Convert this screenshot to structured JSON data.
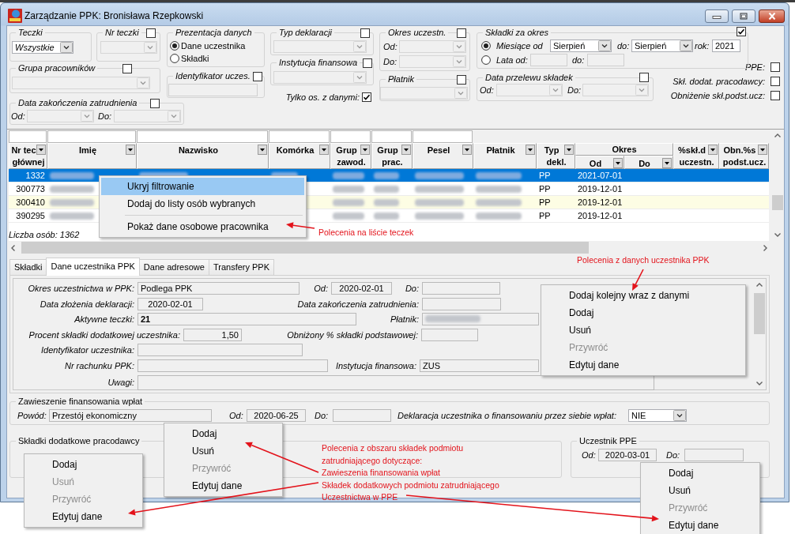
{
  "window": {
    "title": "Zarządzanie PPK: Bronisława Rzepkowski"
  },
  "filters": {
    "teczki": {
      "label": "Teczki",
      "value": "Wszystkie"
    },
    "nr_teczki": {
      "label": "Nr teczki",
      "checked": false
    },
    "grupa_pracownikow": {
      "label": "Grupa pracowników",
      "checked": false
    },
    "prezentacja_danych": {
      "label": "Prezentacja danych",
      "options": [
        {
          "label": "Dane uczestnika",
          "selected": true
        },
        {
          "label": "Składki",
          "selected": false
        }
      ]
    },
    "identyfikator_uczes": {
      "label": "Identyfikator uczes.",
      "checked": false
    },
    "data_zakonczenia_zatrudnienia": {
      "label": "Data zakończenia zatrudnienia",
      "checked": false,
      "from_label": "Od:",
      "to_label": "Do:"
    },
    "typ_deklaracji": {
      "label": "Typ deklaracji",
      "checked": false
    },
    "instytucja_finansowa": {
      "label": "Instytucja finansowa",
      "checked": false
    },
    "tylko_os_z_danymi": {
      "label": "Tylko os. z danymi:",
      "checked": true
    },
    "okres_uczestn": {
      "label": "Okres uczestn.",
      "checked": false,
      "from_label": "Od:",
      "to_label": "Do:"
    },
    "platnik": {
      "label": "Płatnik",
      "checked": false
    },
    "skladki_za_okres": {
      "label": "Składki za okres",
      "checked": true,
      "months": {
        "label": "Miesiące od",
        "selected": true,
        "from": "Sierpień",
        "to_label": "do:",
        "to": "Sierpień",
        "year_label": "rok:",
        "year": "2021"
      },
      "years": {
        "label": "Lata od:",
        "selected": false,
        "to_label": "do:"
      }
    },
    "data_przelewu_skladek": {
      "label": "Data przelewu składek",
      "checked": false,
      "from_label": "Od:",
      "to_label": "Do:"
    },
    "flags": [
      {
        "label": "PPE:",
        "checked": false
      },
      {
        "label": "Skł. dodat. pracodawcy:",
        "checked": false
      },
      {
        "label": "Obniżenie skł.podst.ucz:",
        "checked": false
      }
    ]
  },
  "table": {
    "columns": [
      {
        "lines": [
          "Nr tec",
          "głównej"
        ],
        "filter": true
      },
      {
        "lines": [
          "Imię"
        ],
        "filter": true
      },
      {
        "lines": [
          "Nazwisko"
        ],
        "filter": true
      },
      {
        "lines": [
          "Komórka"
        ],
        "filter": true
      },
      {
        "lines": [
          "Grup",
          "zawod."
        ],
        "filter": true
      },
      {
        "lines": [
          "Grup",
          "prac."
        ],
        "filter": true
      },
      {
        "lines": [
          "Pesel"
        ],
        "filter": true
      },
      {
        "lines": [
          "Płatnik"
        ],
        "filter": false
      },
      {
        "lines": [
          "Typ",
          "dekl."
        ],
        "filter": false
      },
      {
        "lines": [
          "Okres"
        ],
        "filter": false,
        "subcolumns": [
          "Od",
          "Do"
        ]
      },
      {
        "lines": [
          "%skł.d",
          "uczestn."
        ],
        "filter": false
      },
      {
        "lines": [
          "Obn.%s",
          "podst.ucz."
        ],
        "filter": false
      }
    ],
    "rows": [
      {
        "selected": true,
        "highlighted": false,
        "cells": [
          {
            "kind": "text",
            "text": "1332"
          },
          {
            "kind": "blurred"
          },
          {
            "kind": "blurred"
          },
          {
            "kind": "blurred"
          },
          {
            "kind": "blurred"
          },
          {
            "kind": "blurred"
          },
          {
            "kind": "blurred"
          },
          {
            "kind": "blurred"
          },
          {
            "kind": "text",
            "text": "PP"
          },
          {
            "kind": "text",
            "text": "2021-07-01"
          },
          {
            "kind": "empty"
          },
          {
            "kind": "empty"
          },
          {
            "kind": "empty"
          }
        ]
      },
      {
        "selected": false,
        "highlighted": false,
        "cells": [
          {
            "kind": "text",
            "text": "300773"
          },
          {
            "kind": "blurred"
          },
          {
            "kind": "empty"
          },
          {
            "kind": "empty"
          },
          {
            "kind": "blurred"
          },
          {
            "kind": "blurred"
          },
          {
            "kind": "blurred"
          },
          {
            "kind": "blurred"
          },
          {
            "kind": "text",
            "text": "PP"
          },
          {
            "kind": "text",
            "text": "2019-12-01"
          },
          {
            "kind": "empty"
          },
          {
            "kind": "empty"
          },
          {
            "kind": "empty"
          }
        ]
      },
      {
        "selected": false,
        "highlighted": true,
        "cells": [
          {
            "kind": "text",
            "text": "300410"
          },
          {
            "kind": "blurred"
          },
          {
            "kind": "empty"
          },
          {
            "kind": "empty"
          },
          {
            "kind": "blurred"
          },
          {
            "kind": "blurred"
          },
          {
            "kind": "blurred"
          },
          {
            "kind": "blurred"
          },
          {
            "kind": "text",
            "text": "PP"
          },
          {
            "kind": "text",
            "text": "2019-12-01"
          },
          {
            "kind": "empty"
          },
          {
            "kind": "empty"
          },
          {
            "kind": "empty"
          }
        ]
      },
      {
        "selected": false,
        "highlighted": false,
        "cells": [
          {
            "kind": "text",
            "text": "390295"
          },
          {
            "kind": "blurred"
          },
          {
            "kind": "empty"
          },
          {
            "kind": "empty"
          },
          {
            "kind": "blurred"
          },
          {
            "kind": "blurred"
          },
          {
            "kind": "blurred"
          },
          {
            "kind": "blurred"
          },
          {
            "kind": "text",
            "text": "PP"
          },
          {
            "kind": "text",
            "text": "2019-12-01"
          },
          {
            "kind": "empty"
          },
          {
            "kind": "empty"
          },
          {
            "kind": "empty"
          }
        ]
      }
    ],
    "count": "Liczba osób: 1362"
  },
  "tabs": [
    {
      "label": "Składki",
      "selected": false
    },
    {
      "label": "Dane uczestnika PPK",
      "selected": true
    },
    {
      "label": "Dane adresowe",
      "selected": false
    },
    {
      "label": "Transfery PPK",
      "selected": false
    }
  ],
  "participant_form": {
    "rows": [
      [
        {
          "label": "Okres uczestnictwa w PPK:",
          "kind": "text",
          "value": "Podlega PPK"
        },
        {
          "label": "Od:",
          "kind": "text",
          "value": "2020-02-01"
        },
        {
          "label": "Do:",
          "kind": "empty"
        }
      ],
      [
        {
          "label": "Data złożenia deklaracji:",
          "kind": "text",
          "value": "2020-02-01"
        },
        {
          "label": "Data zakończenia zatrudnienia:",
          "kind": "empty"
        }
      ],
      [
        {
          "label": "Aktywne teczki:",
          "kind": "text",
          "value": "21"
        },
        {
          "label": "Płatnik:",
          "kind": "blurred"
        }
      ],
      [
        {
          "label": "Procent składki dodatkowej uczestnika:",
          "kind": "text",
          "value": "1,50"
        },
        {
          "label": "Obniżony % składki podstawowej:",
          "kind": "empty"
        }
      ],
      [
        {
          "label": "Identyfikator uczestnika:",
          "kind": "empty"
        }
      ],
      [
        {
          "label": "Nr rachunku PPK:",
          "kind": "empty"
        },
        {
          "label": "Instytucja finansowa:",
          "kind": "text",
          "value": "ZUS"
        }
      ],
      [
        {
          "label": "Uwagi:",
          "kind": "empty"
        }
      ]
    ]
  },
  "suspension": {
    "label": "Zawieszenie finansowania wpłat",
    "reason_label": "Powód:",
    "reason": "Przestój ekonomiczny",
    "from_label": "Od:",
    "from": "2020-06-25",
    "to_label": "Do:",
    "declaration_label": "Deklaracja uczestnika o finansowaniu przez siebie wpłat:",
    "declaration": "NIE"
  },
  "employer_contributions": {
    "label": "Składki dodatkowe pracodawcy"
  },
  "ppe": {
    "label": "Uczestnik PPE",
    "from_label": "Od:",
    "from": "2020-03-01",
    "to_label": "Do:"
  },
  "context_menus": [
    {
      "items": [
        {
          "kind": "item",
          "label": "Ukryj filtrowanie",
          "highlighted": true,
          "disabled": false
        },
        {
          "kind": "item",
          "label": "Dodaj do listy osób wybranych",
          "highlighted": false,
          "disabled": false
        },
        {
          "kind": "separator"
        },
        {
          "kind": "item",
          "label": "Pokaż dane osobowe pracownika",
          "highlighted": false,
          "disabled": false
        }
      ]
    },
    {
      "items": [
        {
          "kind": "item",
          "label": "Dodaj kolejny wraz z danymi",
          "disabled": false
        },
        {
          "kind": "item",
          "label": "Dodaj",
          "disabled": false
        },
        {
          "kind": "item",
          "label": "Usuń",
          "disabled": false
        },
        {
          "kind": "item",
          "label": "Przywróć",
          "disabled": true
        },
        {
          "kind": "item",
          "label": "Edytuj dane",
          "disabled": false
        }
      ]
    },
    {
      "items": [
        {
          "kind": "item",
          "label": "Dodaj",
          "disabled": false
        },
        {
          "kind": "item",
          "label": "Usuń",
          "disabled": false
        },
        {
          "kind": "item",
          "label": "Przywróć",
          "disabled": true
        },
        {
          "kind": "item",
          "label": "Edytuj dane",
          "disabled": false
        }
      ]
    },
    {
      "items": [
        {
          "kind": "item",
          "label": "Dodaj",
          "disabled": false
        },
        {
          "kind": "item",
          "label": "Usuń",
          "disabled": true
        },
        {
          "kind": "item",
          "label": "Przywróć",
          "disabled": true
        },
        {
          "kind": "item",
          "label": "Edytuj dane",
          "disabled": false
        }
      ]
    },
    {
      "items": [
        {
          "kind": "item",
          "label": "Dodaj",
          "disabled": false
        },
        {
          "kind": "item",
          "label": "Usuń",
          "disabled": false
        },
        {
          "kind": "item",
          "label": "Przywróć",
          "disabled": true
        },
        {
          "kind": "item",
          "label": "Edytuj dane",
          "disabled": false
        }
      ]
    }
  ],
  "annotations": [
    {
      "lines": [
        "Polecenia na liście teczek"
      ]
    },
    {
      "lines": [
        "Polecenia z danych uczestnika PPK"
      ]
    },
    {
      "lines": [
        "Polecenia z obszaru składek podmiotu",
        "zatrudniającego dotyczące:",
        "Zawieszenia finansowania wpłat",
        "Składek dodatkowych podmiotu zatrudniającego",
        "Uczestnictwa w PPE"
      ]
    }
  ]
}
